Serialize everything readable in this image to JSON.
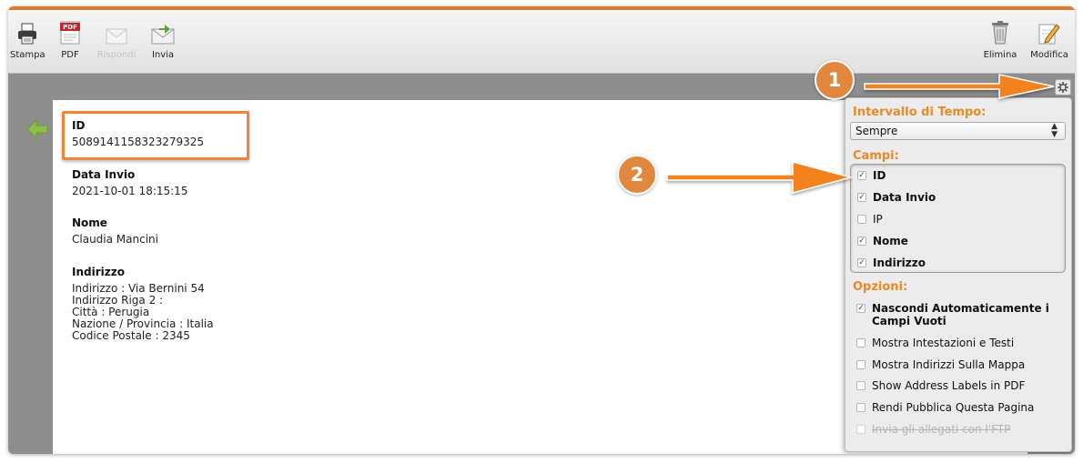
{
  "toolbar": {
    "stampa": "Stampa",
    "pdf": "PDF",
    "rispondi": "Rispondi",
    "invia": "Invia",
    "elimina": "Elimina",
    "modifica": "Modifica"
  },
  "submission": {
    "id": {
      "label": "ID",
      "value": "5089141158323279325"
    },
    "data_invio": {
      "label": "Data Invio",
      "value": "2021-10-01 18:15:15"
    },
    "nome": {
      "label": "Nome",
      "value": "Claudia Mancini"
    },
    "indirizzo": {
      "label": "Indirizzo",
      "lines": [
        "Indirizzo : Via Bernini 54",
        "Indirizzo Riga 2 :",
        "Città : Perugia",
        "Nazione / Provincia : Italia",
        "Codice Postale : 2345"
      ]
    }
  },
  "settings": {
    "time_range_title": "Intervallo di Tempo:",
    "time_range_value": "Sempre",
    "fields_title": "Campi:",
    "fields": [
      {
        "label": "ID",
        "checked": true
      },
      {
        "label": "Data Invio",
        "checked": true
      },
      {
        "label": "IP",
        "checked": false
      },
      {
        "label": "Nome",
        "checked": true
      },
      {
        "label": "Indirizzo",
        "checked": true
      }
    ],
    "options_title": "Opzioni:",
    "options": [
      {
        "label": "Nascondi Automaticamente i Campi Vuoti",
        "checked": true
      },
      {
        "label": "Mostra Intestazioni e Testi",
        "checked": false
      },
      {
        "label": "Mostra Indirizzi Sulla Mappa",
        "checked": false
      },
      {
        "label": "Show Address Labels in PDF",
        "checked": false
      },
      {
        "label": "Rendi Pubblica Questa Pagina",
        "checked": false
      },
      {
        "label": "Invia gli allegati con l'FTP",
        "checked": false,
        "disabled": true
      }
    ]
  },
  "callouts": {
    "one": "1",
    "two": "2"
  },
  "colors": {
    "accent": "#e2873e",
    "settings_title": "#e88a25",
    "highlight": "#f0843a"
  }
}
